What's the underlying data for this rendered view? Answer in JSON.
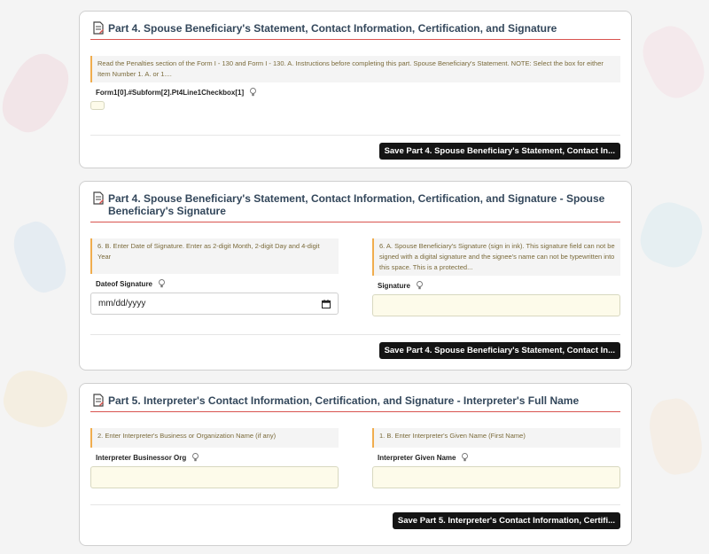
{
  "colors": {
    "accent_line": "#d9534f",
    "header_text": "#33475b",
    "note_border": "#f0ad4e",
    "input_bg": "#fdfbea",
    "button_bg": "#141414"
  },
  "sections": [
    {
      "title": "Part 4. Spouse Beneficiary's Statement, Contact Information, Certification, and Signature",
      "instruction": "Read the Penalties section of the Form I - 130 and Form I - 130. A. Instructions before completing this part. Spouse Beneficiary's Statement. NOTE: Select the box for either Item Number 1. A. or 1....",
      "field_label": "Form1[0].#Subform[2].Pt4Line1Checkbox[1]",
      "save_label": "Save Part 4. Spouse Beneficiary's Statement, Contact In..."
    },
    {
      "title": "Part 4. Spouse Beneficiary's Statement, Contact Information, Certification, and Signature - Spouse Beneficiary's Signature",
      "left": {
        "instruction": "6. B. Enter Date of Signature. Enter as 2-digit Month, 2-digit Day and 4-digit Year",
        "label": "Dateof Signature",
        "value": "mm/dd/yyyy"
      },
      "right": {
        "instruction": "6. A. Spouse Beneficiary's Signature (sign in ink). This signature field can not be signed with a digital signature and the signee's name can not be typewritten into this space. This is a protected...",
        "label": "Signature",
        "value": ""
      },
      "save_label": "Save Part 4. Spouse Beneficiary's Statement, Contact In..."
    },
    {
      "title": "Part 5. Interpreter's Contact Information, Certification, and Signature - Interpreter's Full Name",
      "left": {
        "instruction": "2. Enter Interpreter's Business or Organization Name (if any)",
        "label": "Interpreter Businessor Org",
        "value": ""
      },
      "right": {
        "instruction": "1. B. Enter Interpreter's Given Name (First Name)",
        "label": "Interpreter Given Name",
        "value": ""
      },
      "save_label": "Save Part 5. Interpreter's Contact Information, Certifi..."
    }
  ]
}
